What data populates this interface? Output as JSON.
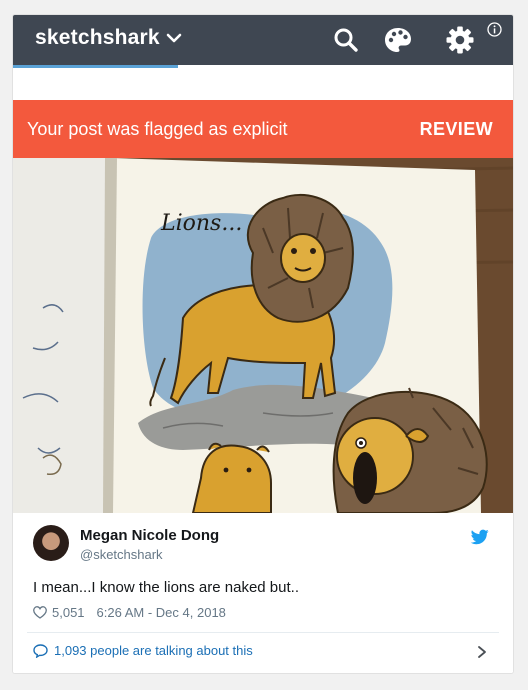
{
  "header": {
    "blog_name": "sketchshark",
    "progress_fraction": 0.33,
    "icons": [
      "chevron-down-icon",
      "search-icon",
      "palette-icon",
      "gear-icon",
      "info-icon"
    ]
  },
  "flag": {
    "message": "Your post was flagged as explicit",
    "action_label": "REVIEW",
    "color": "#f3593d"
  },
  "artwork": {
    "caption": "Lions..."
  },
  "tweet": {
    "author_name": "Megan Nicole Dong",
    "author_handle": "@sketchshark",
    "text": "I mean...I know the lions are naked but..",
    "likes": "5,051",
    "timestamp": "6:26 AM - Dec 4, 2018",
    "talking": "1,093 people are talking about this",
    "brand_color": "#1da1f2",
    "link_color": "#1b6fb5"
  }
}
